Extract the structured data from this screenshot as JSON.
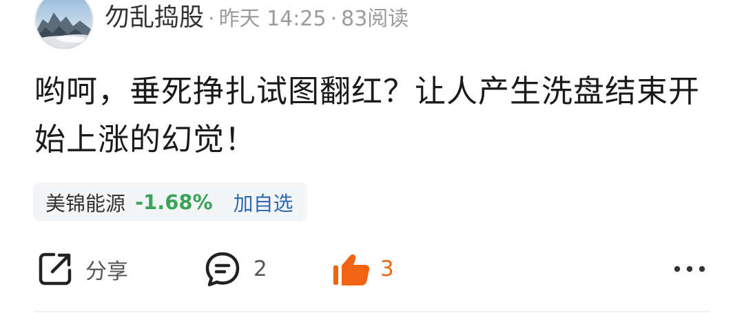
{
  "header": {
    "author": "勿乱捣股",
    "time": "昨天 14:25",
    "reads": "83阅读",
    "separator": "·"
  },
  "post": {
    "text": "哟呵，垂死挣扎试图翻红？让人产生洗盘结束开始上涨的幻觉！"
  },
  "stock": {
    "name": "美锦能源",
    "change": "-1.68%",
    "add_label": "加自选",
    "change_color": "#3aa55a"
  },
  "actions": {
    "share_label": "分享",
    "share_icon": "share-icon",
    "comment_count": "2",
    "comment_icon": "comment-icon",
    "like_count": "3",
    "like_icon": "thumbs-up-icon",
    "like_color": "#f06414",
    "more_icon": "more-icon"
  }
}
